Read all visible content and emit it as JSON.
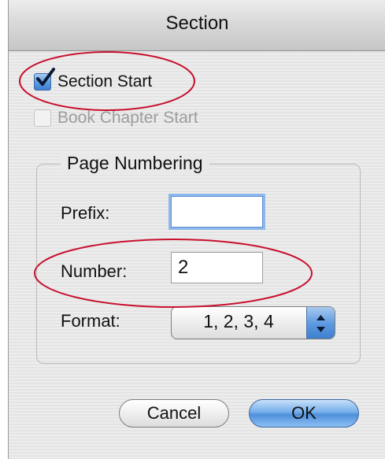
{
  "window": {
    "title": "Section"
  },
  "section_start": {
    "label": "Section Start",
    "checked": true
  },
  "book_chapter_start": {
    "label": "Book Chapter Start",
    "checked": false,
    "enabled": false
  },
  "page_numbering": {
    "group_title": "Page Numbering",
    "prefix_label": "Prefix:",
    "prefix_value": "",
    "number_label": "Number:",
    "number_value": "2",
    "format_label": "Format:",
    "format_value": "1, 2, 3, 4"
  },
  "buttons": {
    "cancel_label": "Cancel",
    "ok_label": "OK"
  },
  "icons": {
    "checkmark": "checkmark-icon",
    "popup_arrows": "up-down-arrows-icon"
  },
  "colors": {
    "accent_blue": "#5d9ae0",
    "annotation_red": "#c8102e"
  }
}
